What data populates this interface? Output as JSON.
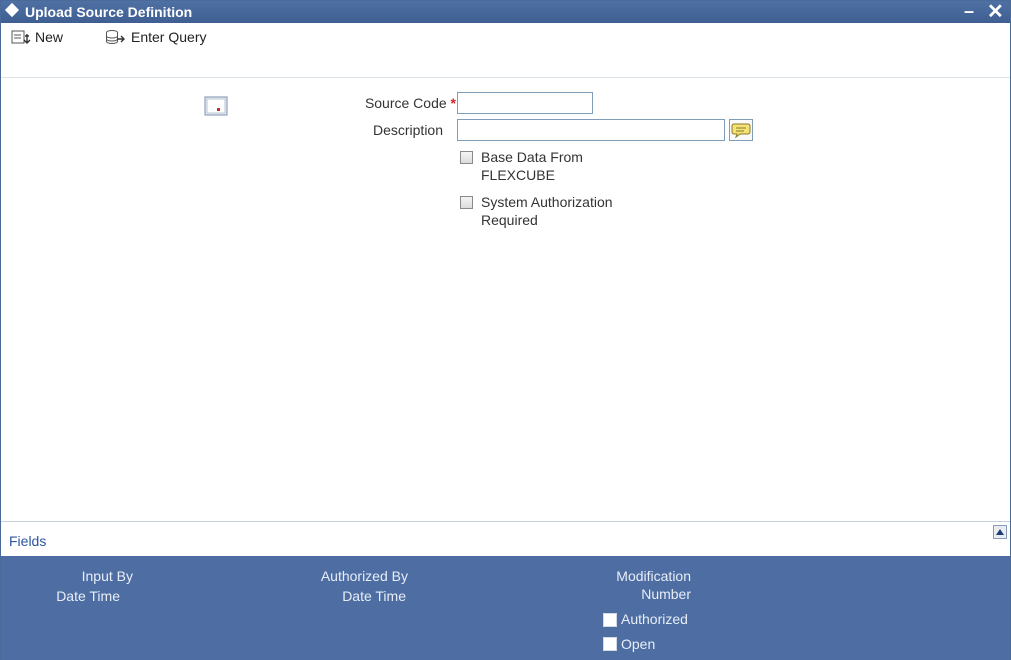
{
  "window": {
    "title": "Upload Source Definition",
    "minimize": "–",
    "close": "✕"
  },
  "toolbar": {
    "new_label": "New",
    "enter_query_label": "Enter Query"
  },
  "form": {
    "source_code_label": "Source Code",
    "required_marker": "*",
    "source_code_value": "",
    "description_label": "Description",
    "description_value": "",
    "base_data_label_line1": "Base Data From",
    "base_data_label_line2": "FLEXCUBE",
    "sys_auth_label_line1": "System Authorization",
    "sys_auth_label_line2": "Required"
  },
  "fields_section": {
    "label": "Fields"
  },
  "audit": {
    "input_by": "Input By",
    "input_date_time": "Date Time",
    "authorized_by": "Authorized By",
    "authorized_date_time": "Date Time",
    "modification_line1": "Modification",
    "modification_line2": "Number",
    "authorized_label": "Authorized",
    "open_label": "Open"
  },
  "colors": {
    "titlebar": "#4f70a3",
    "audit_bg": "#4d6da3",
    "link": "#2c55a0",
    "required": "#d22222"
  },
  "icons": {
    "new": "new-document-icon",
    "enter_query": "query-icon",
    "side": "record-icon",
    "lov": "list-of-values-icon",
    "collapse": "collapse-up-icon"
  }
}
